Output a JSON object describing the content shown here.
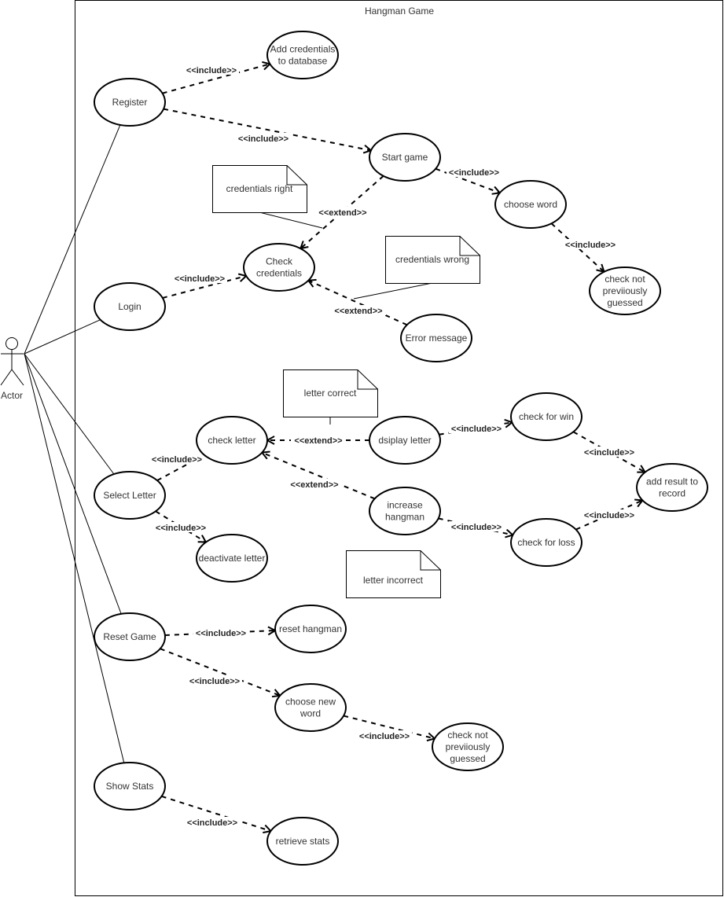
{
  "diagram": {
    "title": "Hangman Game",
    "actor": {
      "id": "actor",
      "label": "Actor"
    },
    "use_cases": [
      {
        "id": "register",
        "lines": [
          "Register"
        ]
      },
      {
        "id": "add-credentials",
        "lines": [
          "Add credentials",
          "to database"
        ]
      },
      {
        "id": "start-game",
        "lines": [
          "Start game"
        ]
      },
      {
        "id": "choose-word",
        "lines": [
          "choose word"
        ]
      },
      {
        "id": "check-not-guessed-1",
        "lines": [
          "check not",
          "previiously",
          "guessed"
        ]
      },
      {
        "id": "login",
        "lines": [
          "Login"
        ]
      },
      {
        "id": "check-credentials",
        "lines": [
          "Check",
          "credentials"
        ]
      },
      {
        "id": "error-message",
        "lines": [
          "Error message"
        ]
      },
      {
        "id": "select-letter",
        "lines": [
          "Select Letter"
        ]
      },
      {
        "id": "check-letter",
        "lines": [
          "check letter"
        ]
      },
      {
        "id": "deactivate-letter",
        "lines": [
          "deactivate letter"
        ]
      },
      {
        "id": "display-letter",
        "lines": [
          "dsiplay letter"
        ]
      },
      {
        "id": "increase-hangman",
        "lines": [
          "increase",
          "hangman"
        ]
      },
      {
        "id": "check-for-win",
        "lines": [
          "check for win"
        ]
      },
      {
        "id": "check-for-loss",
        "lines": [
          "check for loss"
        ]
      },
      {
        "id": "add-result",
        "lines": [
          "add result to",
          "record"
        ]
      },
      {
        "id": "reset-game",
        "lines": [
          "Reset Game"
        ]
      },
      {
        "id": "reset-hangman",
        "lines": [
          "reset hangman"
        ]
      },
      {
        "id": "choose-new-word",
        "lines": [
          "choose new",
          "word"
        ]
      },
      {
        "id": "check-not-guessed-2",
        "lines": [
          "check not",
          "previiously",
          "guessed"
        ]
      },
      {
        "id": "show-stats",
        "lines": [
          "Show Stats"
        ]
      },
      {
        "id": "retrieve-stats",
        "lines": [
          "retrieve stats"
        ]
      }
    ],
    "notes": [
      {
        "id": "note-credentials-right",
        "text": "credentials right"
      },
      {
        "id": "note-credentials-wrong",
        "text": "credentials wrong"
      },
      {
        "id": "note-letter-correct",
        "text": "letter correct"
      },
      {
        "id": "note-letter-incorrect",
        "text": "letter incorrect"
      }
    ],
    "associations": [
      {
        "from": "actor",
        "to": "register"
      },
      {
        "from": "actor",
        "to": "login"
      },
      {
        "from": "actor",
        "to": "select-letter"
      },
      {
        "from": "actor",
        "to": "reset-game"
      },
      {
        "from": "actor",
        "to": "show-stats"
      }
    ],
    "relations": [
      {
        "from": "register",
        "to": "add-credentials",
        "label": "<<include>>"
      },
      {
        "from": "register",
        "to": "start-game",
        "label": "<<include>>"
      },
      {
        "from": "start-game",
        "to": "choose-word",
        "label": "<<include>>"
      },
      {
        "from": "choose-word",
        "to": "check-not-guessed-1",
        "label": "<<include>>"
      },
      {
        "from": "start-game",
        "to": "check-credentials",
        "label": "<<extend>>"
      },
      {
        "from": "login",
        "to": "check-credentials",
        "label": "<<include>>"
      },
      {
        "from": "error-message",
        "to": "check-credentials",
        "label": "<<extend>>"
      },
      {
        "from": "select-letter",
        "to": "check-letter",
        "label": "<<include>>"
      },
      {
        "from": "select-letter",
        "to": "deactivate-letter",
        "label": "<<include>>"
      },
      {
        "from": "display-letter",
        "to": "check-letter",
        "label": "<<extend>>"
      },
      {
        "from": "increase-hangman",
        "to": "check-letter",
        "label": "<<extend>>"
      },
      {
        "from": "display-letter",
        "to": "check-for-win",
        "label": "<<include>>"
      },
      {
        "from": "increase-hangman",
        "to": "check-for-loss",
        "label": "<<include>>"
      },
      {
        "from": "check-for-win",
        "to": "add-result",
        "label": "<<include>>"
      },
      {
        "from": "check-for-loss",
        "to": "add-result",
        "label": "<<include>>"
      },
      {
        "from": "reset-game",
        "to": "reset-hangman",
        "label": "<<include>>"
      },
      {
        "from": "reset-game",
        "to": "choose-new-word",
        "label": "<<include>>"
      },
      {
        "from": "choose-new-word",
        "to": "check-not-guessed-2",
        "label": "<<include>>"
      },
      {
        "from": "show-stats",
        "to": "retrieve-stats",
        "label": "<<include>>"
      }
    ],
    "note_links": [
      {
        "note": "note-credentials-right",
        "relation": 4
      },
      {
        "note": "note-credentials-wrong",
        "relation": 6
      },
      {
        "note": "note-letter-correct",
        "relation": 9
      },
      {
        "note": "note-letter-incorrect",
        "relation": 10
      }
    ]
  }
}
